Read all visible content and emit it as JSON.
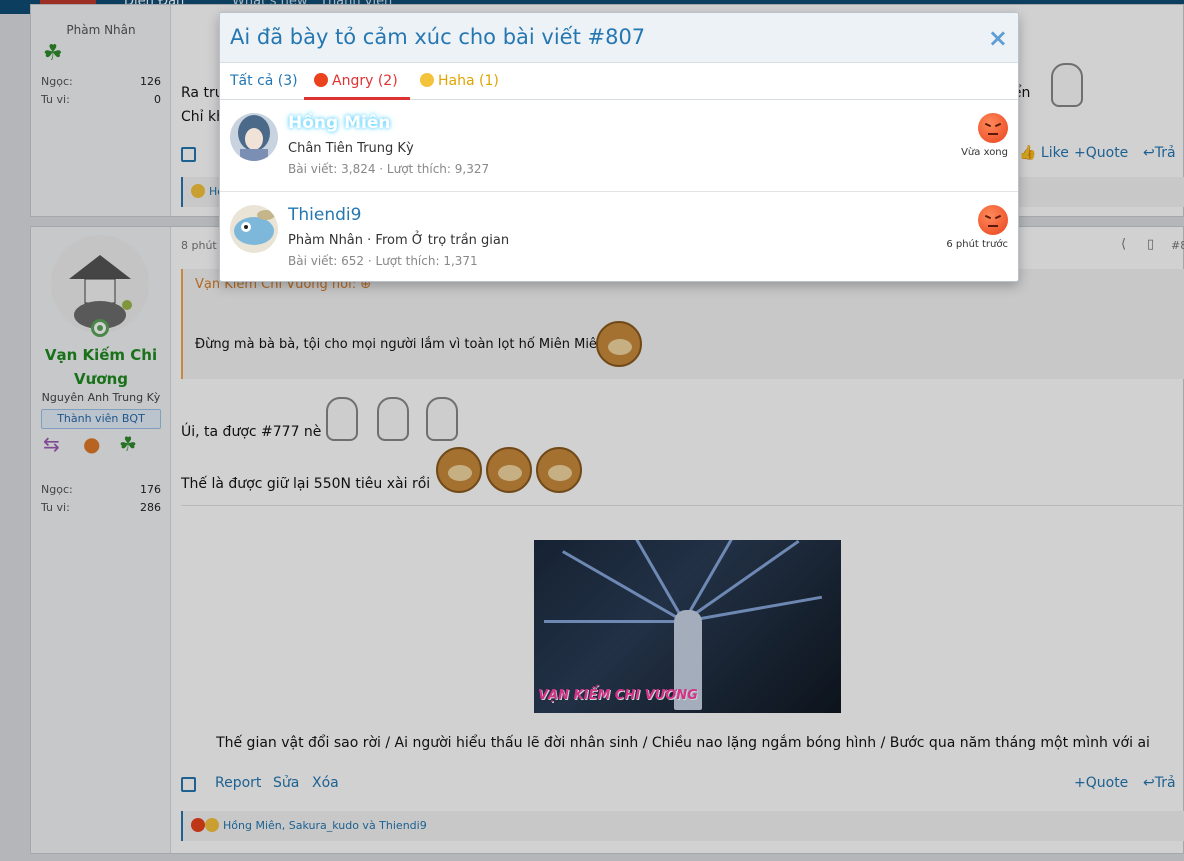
{
  "nav": {
    "tab_active": "Diễn Đàn",
    "tab_whats_new": "What's new",
    "tab_members": "Thành viên"
  },
  "post1": {
    "rank": "Phàm Nhân",
    "stat1_label": "Ngọc:",
    "stat1_value": "126",
    "stat2_label": "Tu vi:",
    "stat2_value": "0",
    "line1_start": "Ra tru",
    "line1_end": "iển",
    "line2_start": "Chỉ kh",
    "react_names": "Hồ",
    "actions": {
      "like": "Like",
      "quote": "Quote",
      "reply": "Trả"
    }
  },
  "post2": {
    "author": "Vạn Kiếm Chi Vương",
    "author_title": "Nguyên Anh Trung Kỳ",
    "author_badge": "Thành viên BQT",
    "stat1_label": "Ngọc:",
    "stat1_value": "176",
    "stat2_label": "Tu vi:",
    "stat2_value": "286",
    "time": "8 phút",
    "post_num": "#8",
    "quote_head": "Vạn Kiếm Chi Vương nói: ⊕",
    "quote_body": "Đừng mà bà bà, tội cho mọi người lắm vì toàn lọt hố Miên Miên",
    "line1": "Úi, ta được #777 nè",
    "line2": "Thế là được giữ lại 550N tiêu xài rồi",
    "media_watermark": "VẠN KIẾM CHI VƯƠNG",
    "caption": "Thế gian vật đổi sao rời / Ai người hiểu thấu lẽ đời nhân sinh / Chiều nao lặng ngắm bóng hình / Bước qua năm tháng một mình với ai",
    "actions": {
      "report": "Report",
      "edit": "Sửa",
      "delete": "Xóa",
      "quote": "Quote",
      "reply": "Trả"
    },
    "react_names": "Hồng Miên, Sakura_kudo và Thiendi9"
  },
  "modal": {
    "title": "Ai đã bày tỏ cảm xúc cho bài viết #807",
    "close": "×",
    "tabs": [
      {
        "label": "Tất cả (3)"
      },
      {
        "label": "Angry (2)"
      },
      {
        "label": "Haha (1)"
      }
    ],
    "rows": [
      {
        "name": "Hồng Miên",
        "sub": "Chân Tiên Trung Kỳ",
        "stats": "Bài viết: 3,824 · Lượt thích: 9,327",
        "time": "Vừa xong",
        "reaction": "angry"
      },
      {
        "name": "Thiendi9",
        "sub": "Phàm Nhân · From Ở trọ trần gian",
        "stats": "Bài viết: 652 · Lượt thích: 1,371",
        "time": "6 phút trước",
        "reaction": "angry"
      }
    ]
  },
  "colors": {
    "link": "#2577b1",
    "angry": "#d33333",
    "haha": "#e0a400",
    "nav": "#0e4c75"
  }
}
